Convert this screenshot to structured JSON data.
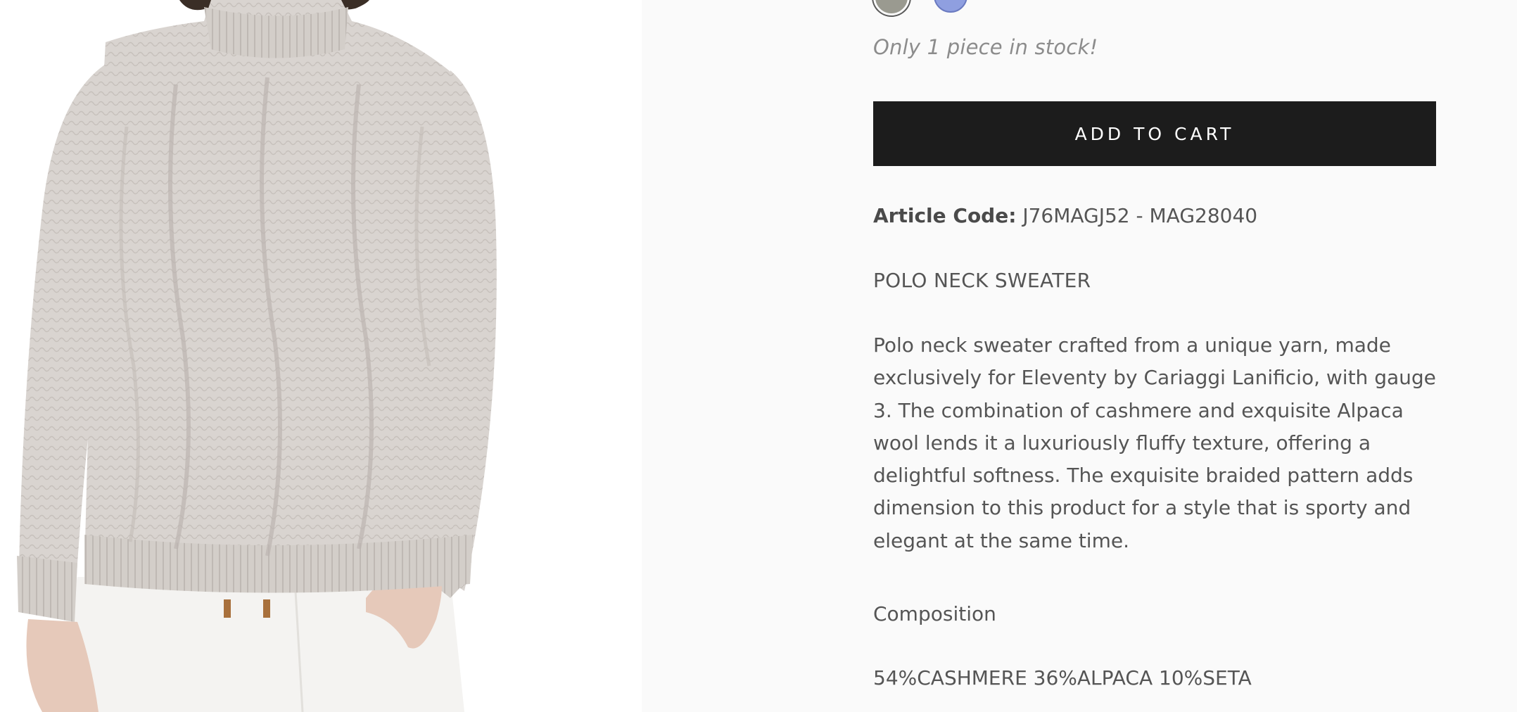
{
  "product": {
    "image_alt": "Model wearing a beige cable-knit polo neck sweater",
    "stock_message": "Only 1 piece in stock!",
    "add_to_cart_label": "ADD TO CART",
    "article_code_label": "Article Code:",
    "article_code_value": "J76MAGJ52 - MAG28040",
    "name": "POLO NECK SWEATER",
    "description": "Polo neck sweater crafted from a unique yarn, made exclusively for Eleventy by Cariaggi Lanificio, with gauge 3. The combination of cashmere and exquisite Alpaca wool lends it a luxuriously fluffy texture, offering a delightful softness. The exquisite braided pattern adds dimension to this product for a style that is sporty and elegant at the same time.",
    "composition_label": "Composition",
    "composition_value": "54%CASHMERE 36%ALPACA 10%SETA"
  },
  "swatches": [
    {
      "name": "grey",
      "color": "#9a9a90",
      "selected": true
    },
    {
      "name": "periwinkle",
      "color": "#8f9fe0",
      "selected": false
    }
  ],
  "colors": {
    "button_bg": "#1c1c1c",
    "button_text": "#ffffff",
    "page_bg": "#fafafa",
    "sweater": "#d8d3cf"
  }
}
